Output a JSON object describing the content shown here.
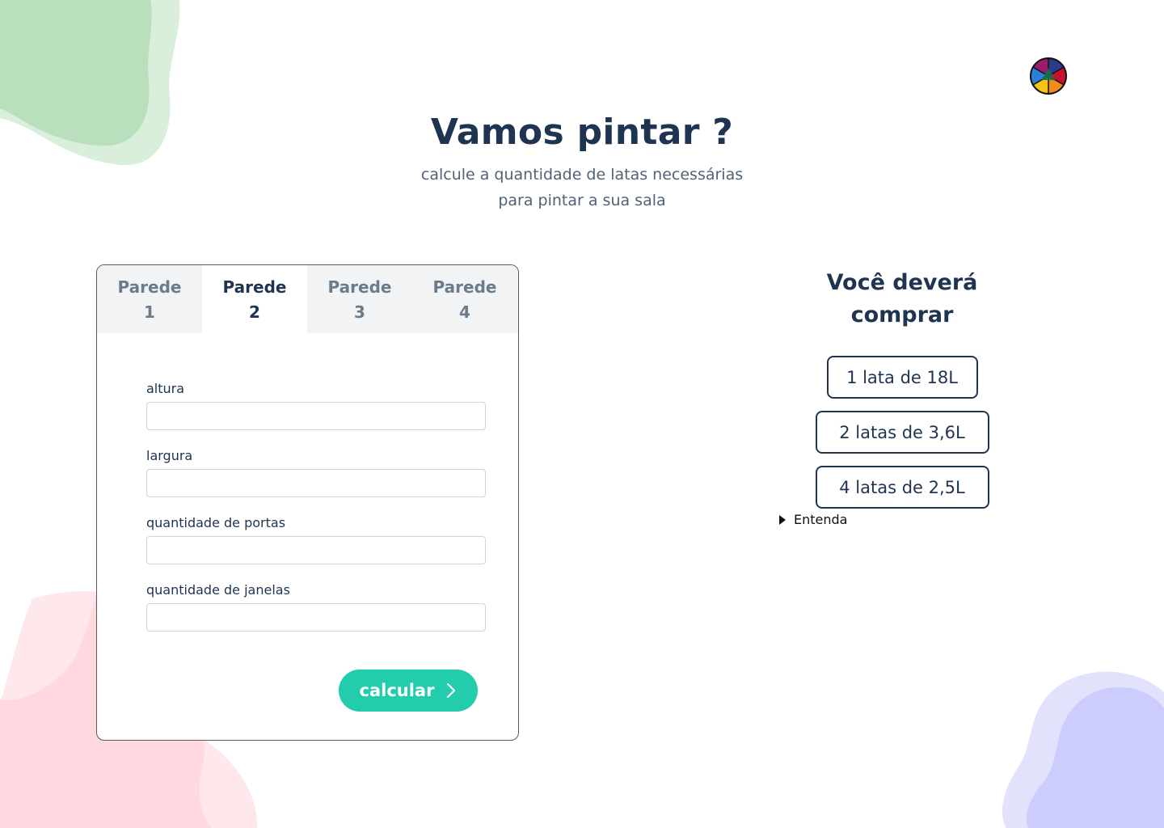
{
  "hero": {
    "title": "Vamos pintar ?",
    "subtitle_line1": "calcule a quantidade de latas necessárias",
    "subtitle_line2": "para pintar a sua sala"
  },
  "tabs": [
    {
      "word": "Parede",
      "number": "1",
      "active": false
    },
    {
      "word": "Parede",
      "number": "2",
      "active": true
    },
    {
      "word": "Parede",
      "number": "3",
      "active": false
    },
    {
      "word": "Parede",
      "number": "4",
      "active": false
    }
  ],
  "form": {
    "fields": [
      {
        "label": "altura",
        "value": ""
      },
      {
        "label": "largura",
        "value": ""
      },
      {
        "label": "quantidade de portas",
        "value": ""
      },
      {
        "label": "quantidade de janelas",
        "value": ""
      }
    ],
    "submit_label": "calcular"
  },
  "result": {
    "title": "Você deverá comprar",
    "cans": [
      "1 lata de 18L",
      "2 latas de 3,6L",
      "4 latas de 2,5L"
    ],
    "details_label": "Entenda"
  },
  "icons": {
    "logo": "color-wheel-icon",
    "submit": "chevron-right-icon",
    "details": "disclosure-triangle-icon"
  },
  "colors": {
    "primary_text": "#1f3450",
    "accent": "#22ccad",
    "blob_green": "#b9dfbd",
    "blob_pink": "#ffd9df",
    "blob_purple": "#cdcdfd"
  }
}
